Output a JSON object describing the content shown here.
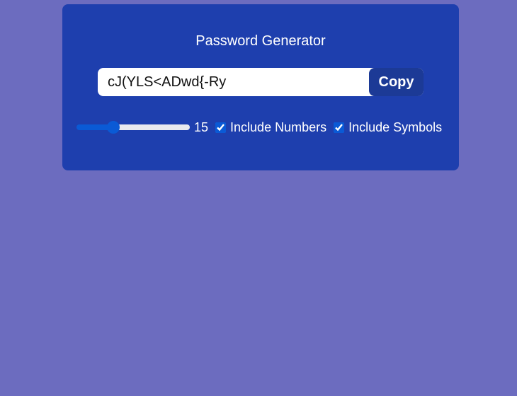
{
  "app": {
    "title": "Password Generator"
  },
  "password": {
    "value": "cJ(YLS<ADwd{-Ry",
    "copy_label": "Copy"
  },
  "options": {
    "length": 15,
    "length_label": "15",
    "length_min": 4,
    "length_max": 40,
    "include_numbers_label": "Include Numbers",
    "include_numbers_checked": true,
    "include_symbols_label": "Include Symbols",
    "include_symbols_checked": true
  },
  "colors": {
    "background": "#6c6cbf",
    "card": "#1e3fae",
    "copy_button": "#1c3a96",
    "accent": "#0a5ad6"
  }
}
